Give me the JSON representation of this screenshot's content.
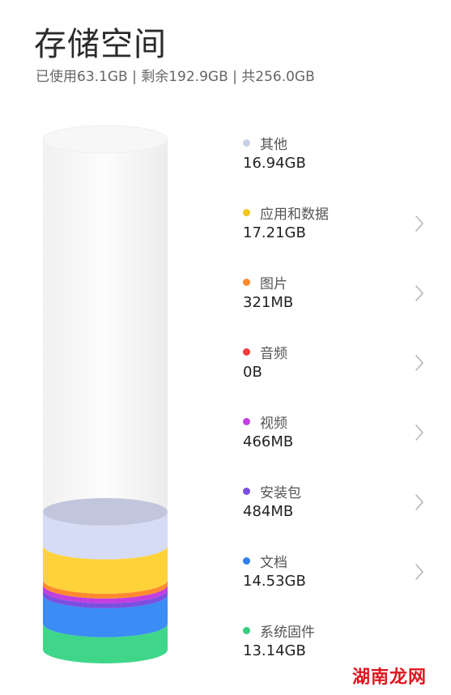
{
  "header": {
    "title": "存储空间",
    "summary": "已使用63.1GB | 剩余192.9GB | 共256.0GB"
  },
  "chart_data": {
    "type": "bar",
    "unit": "GB",
    "total": 256.0,
    "categories": [
      "系统固件",
      "文档",
      "安装包",
      "视频",
      "音频",
      "图片",
      "应用和数据",
      "其他"
    ],
    "values": [
      13.14,
      14.53,
      0.484,
      0.466,
      0,
      0.321,
      17.21,
      16.94
    ],
    "colors": [
      "#3fd68a",
      "#3b8cf5",
      "#7b4fe0",
      "#c13ee0",
      "#ef3b3b",
      "#ff8a30",
      "#ffd23a",
      "#d6dcf5"
    ]
  },
  "categories": [
    {
      "name": "其他",
      "size": "16.94GB",
      "color": "#c5cfe6",
      "has_chevron": false
    },
    {
      "name": "应用和数据",
      "size": "17.21GB",
      "color": "#f5c518",
      "has_chevron": true
    },
    {
      "name": "图片",
      "size": "321MB",
      "color": "#ff8a30",
      "has_chevron": true
    },
    {
      "name": "音频",
      "size": "0B",
      "color": "#ef3b3b",
      "has_chevron": true
    },
    {
      "name": "视频",
      "size": "466MB",
      "color": "#c13ee0",
      "has_chevron": true
    },
    {
      "name": "安装包",
      "size": "484MB",
      "color": "#7b4fe0",
      "has_chevron": true
    },
    {
      "name": "文档",
      "size": "14.53GB",
      "color": "#2f7ff0",
      "has_chevron": true
    },
    {
      "name": "系统固件",
      "size": "13.14GB",
      "color": "#35d07f",
      "has_chevron": false
    }
  ],
  "watermark": "湖南龙网"
}
